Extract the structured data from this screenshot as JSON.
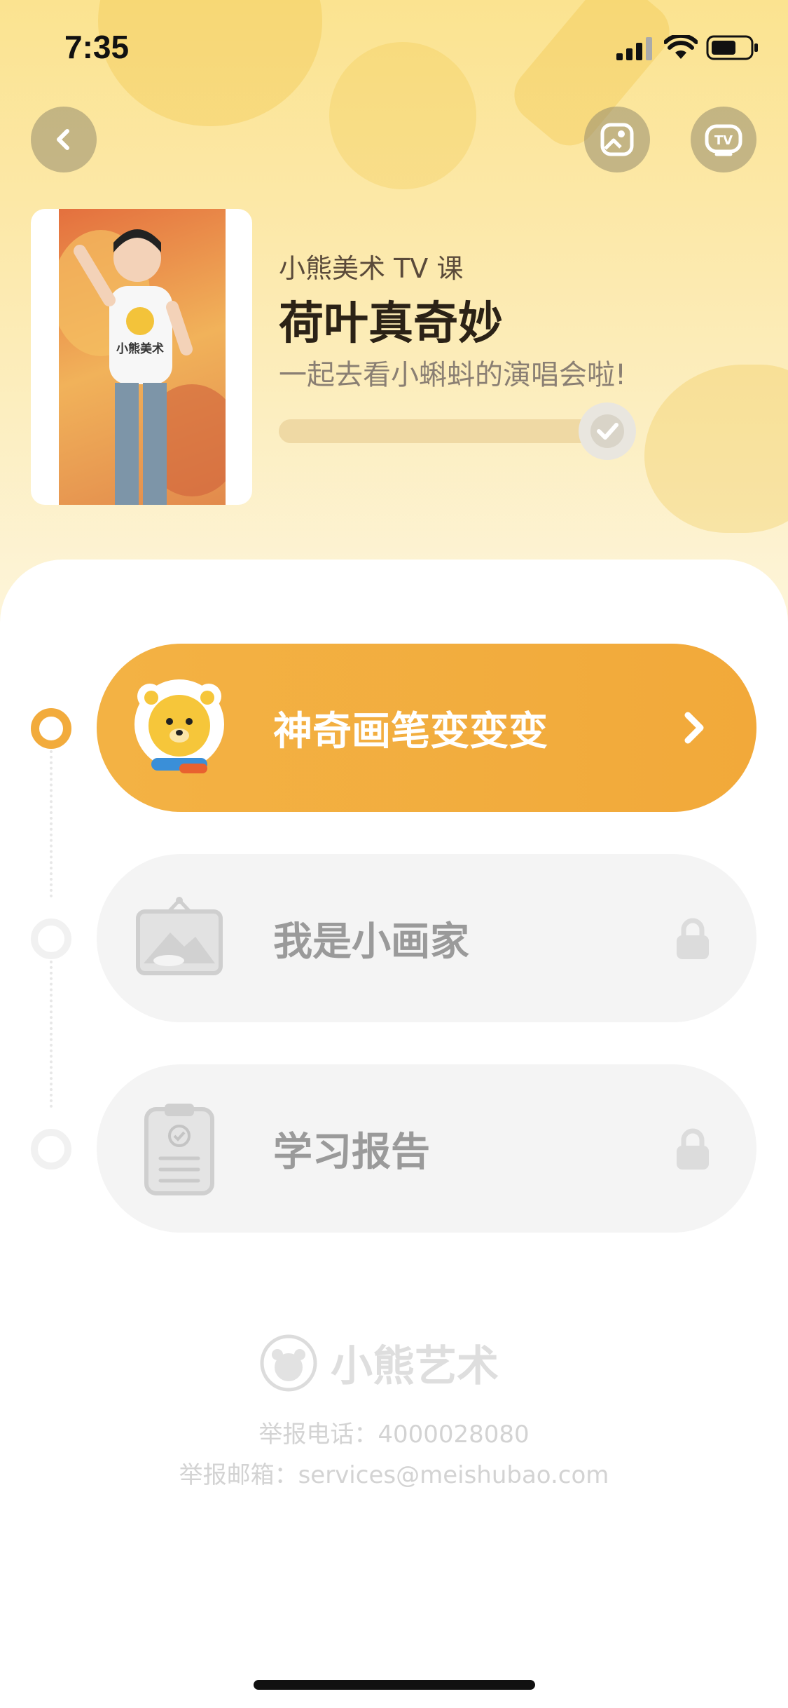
{
  "status_bar": {
    "time": "7:35"
  },
  "header": {
    "back_icon": "chevron-left-icon",
    "actions": [
      {
        "name": "gallery-icon"
      },
      {
        "name": "tv-icon",
        "label": "TV"
      }
    ]
  },
  "course": {
    "subtitle": "小熊美术 TV 课",
    "title": "荷叶真奇妙",
    "description": "一起去看小蝌蚪的演唱会啦!",
    "progress_fraction": 1.0,
    "thumbnail_text": "小熊美术"
  },
  "steps": [
    {
      "label": "神奇画笔变变变",
      "state": "active",
      "icon": "bear-mascot-icon",
      "trailing_icon": "chevron-right-icon"
    },
    {
      "label": "我是小画家",
      "state": "locked",
      "icon": "picture-frame-icon",
      "trailing_icon": "lock-icon"
    },
    {
      "label": "学习报告",
      "state": "locked",
      "icon": "clipboard-icon",
      "trailing_icon": "lock-icon"
    }
  ],
  "footer": {
    "brand": "小熊艺术",
    "phone": "举报电话：4000028080",
    "email": "举报邮箱：services@meishubao.com"
  },
  "colors": {
    "accent": "#f2ab3c",
    "header_bg": "#fbe390",
    "locked_bg": "#f4f4f4"
  }
}
